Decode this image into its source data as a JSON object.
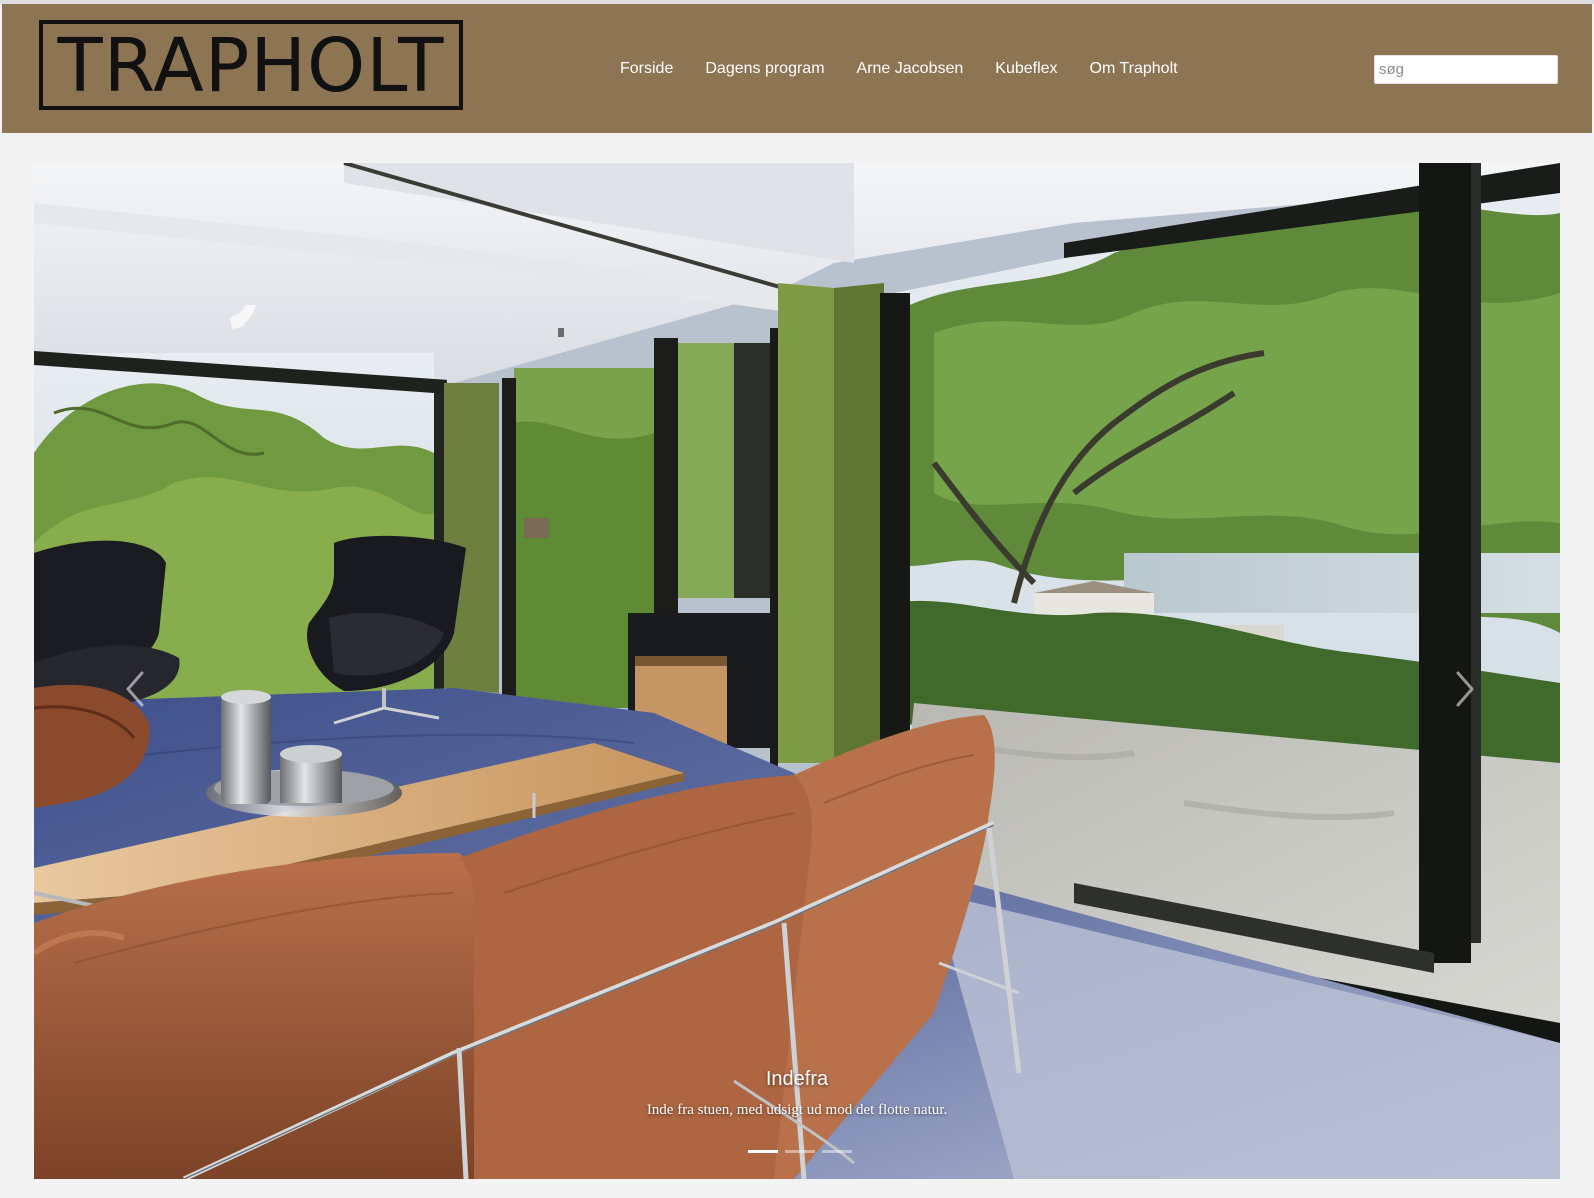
{
  "header": {
    "logo_text": "TRAPHOLT",
    "background_color": "#8d7453"
  },
  "nav": {
    "items": [
      {
        "label": "Forside"
      },
      {
        "label": "Dagens program"
      },
      {
        "label": "Arne Jacobsen"
      },
      {
        "label": "Kubeflex"
      },
      {
        "label": "Om Trapholt"
      }
    ]
  },
  "search": {
    "placeholder": "søg",
    "value": ""
  },
  "carousel": {
    "slide_title": "Indefra",
    "slide_text": "Inde fra stuen, med udsigt ud mod det flotte natur.",
    "slide_count": 3,
    "active_slide": 1,
    "prev_icon": "chevron-left-icon",
    "next_icon": "chevron-right-icon"
  }
}
